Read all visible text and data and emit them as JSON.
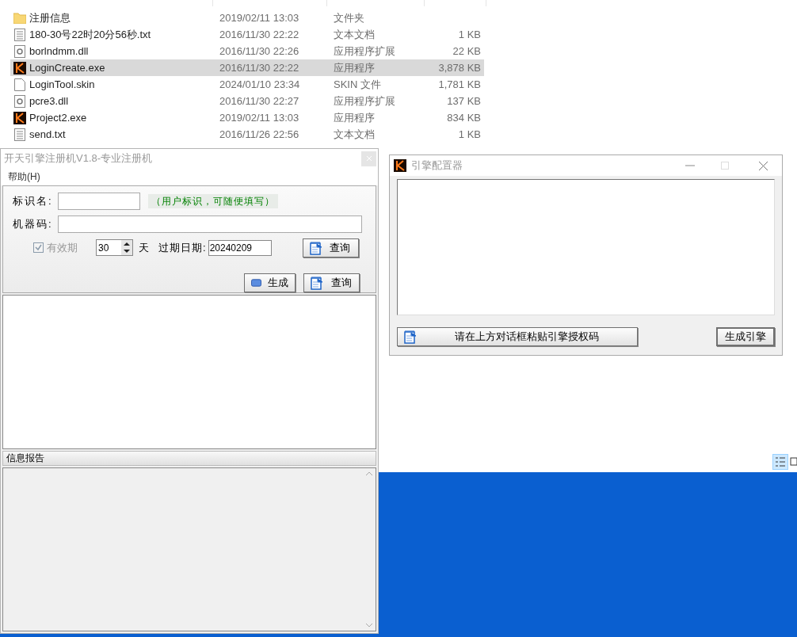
{
  "explorer": {
    "files": [
      {
        "name": "注册信息",
        "date": "2019/02/11 13:03",
        "type": "文件夹",
        "kind": "folder",
        "selected": false
      },
      {
        "name": "180-30号22时20分56秒.txt",
        "date": "2016/11/30 22:22",
        "type": "文本文档",
        "size": "1 KB",
        "kind": "text",
        "selected": false
      },
      {
        "name": "borlndmm.dll",
        "date": "2016/11/30 22:26",
        "type": "应用程序扩展",
        "size": "22 KB",
        "kind": "dll",
        "selected": false
      },
      {
        "name": "LoginCreate.exe",
        "date": "2016/11/30 22:22",
        "type": "应用程序",
        "size": "3,878 KB",
        "kind": "app",
        "selected": true
      },
      {
        "name": "LoginTool.skin",
        "date": "2024/01/10 23:34",
        "type": "SKIN 文件",
        "size": "1,781 KB",
        "kind": "blank",
        "selected": false
      },
      {
        "name": "pcre3.dll",
        "date": "2016/11/30 22:27",
        "type": "应用程序扩展",
        "size": "137 KB",
        "kind": "dll",
        "selected": false
      },
      {
        "name": "Project2.exe",
        "date": "2019/02/11 13:03",
        "type": "应用程序",
        "size": "834 KB",
        "kind": "app",
        "selected": false
      },
      {
        "name": "send.txt",
        "date": "2016/11/26 22:56",
        "type": "文本文档",
        "size": "1 KB",
        "kind": "text",
        "selected": false
      }
    ]
  },
  "register_window": {
    "title": "开天引擎注册机V1.8-专业注册机",
    "menu": [
      "帮助(H)"
    ],
    "id_label": "标识名:",
    "id_hint": "（用户标识，可随便填写）",
    "machine_label": "机器码:",
    "validity": {
      "label": "有效期",
      "checked": true,
      "disabled": true
    },
    "days": "30",
    "days_unit": "天",
    "expiry_label": "过期日期:",
    "expiry_value": "20240209",
    "query_button": "查询",
    "generate_button": "生成",
    "query_button_2": "查询",
    "report_header": "信息报告"
  },
  "engine_window": {
    "title": "引擎配置器",
    "paste_button": "请在上方对话框粘贴引擎授权码",
    "generate_button": "生成引擎"
  }
}
